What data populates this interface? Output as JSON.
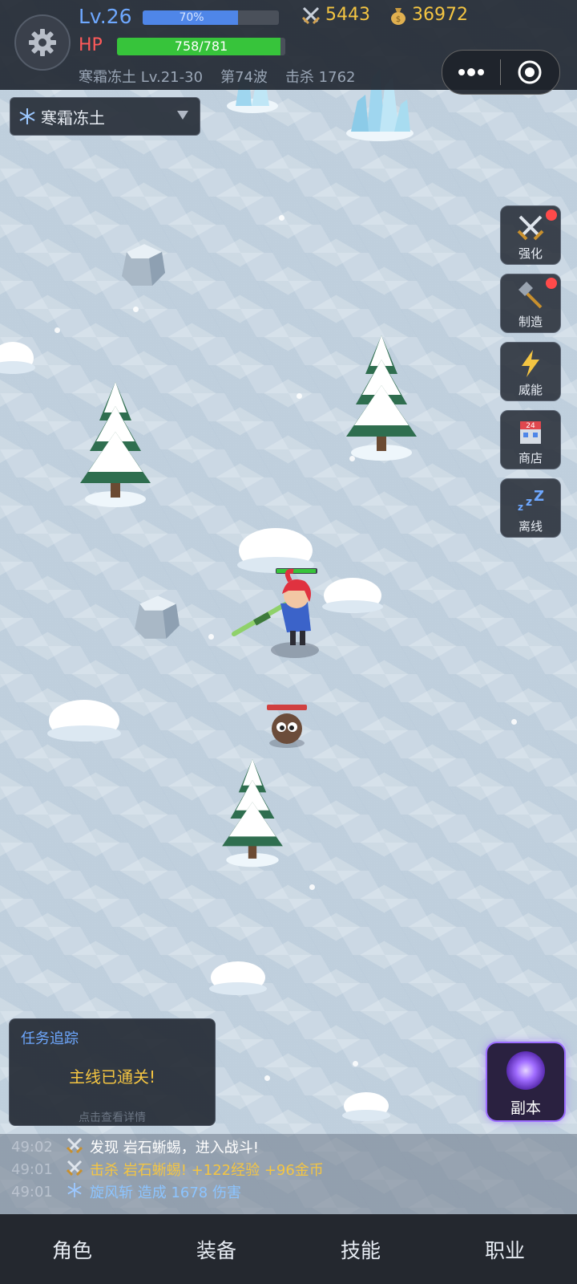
{
  "hud": {
    "level": "Lv.26",
    "xp_percent_text": "70%",
    "xp_progress": 0.7,
    "hp_label": "HP",
    "hp_text": "758/781",
    "hp_progress": 0.97,
    "attack": "5443",
    "gold": "36972",
    "zone_name": "寒霜冻土 Lv.21-30",
    "wave": "第74波",
    "kills": "击杀 1762"
  },
  "zone_selector": {
    "icon": "snowflake-icon",
    "label": "寒霜冻土"
  },
  "side_buttons": [
    {
      "label": "强化",
      "icon": "swords-icon",
      "badge": true
    },
    {
      "label": "制造",
      "icon": "hammer-icon",
      "badge": true
    },
    {
      "label": "威能",
      "icon": "lightning-icon",
      "badge": false
    },
    {
      "label": "商店",
      "icon": "shop-icon",
      "badge": false
    },
    {
      "label": "离线",
      "icon": "sleep-icon",
      "badge": false
    }
  ],
  "quest": {
    "title": "任务追踪",
    "message": "主线已通关!",
    "hint": "点击查看详情"
  },
  "dungeon": {
    "label": "副本",
    "icon": "vortex-icon"
  },
  "log": [
    {
      "time": "49:02",
      "icon": "swords-icon",
      "text": "发现 岩石蜥蜴，进入战斗!",
      "color": "#ffffff"
    },
    {
      "time": "49:01",
      "icon": "swords-icon",
      "text": "击杀 岩石蜥蜴! +122经验 +96金币",
      "color": "#f4c542"
    },
    {
      "time": "49:01",
      "icon": "snowflake-icon",
      "text": "旋风斩 造成 1678 伤害",
      "color": "#8cc4ff"
    }
  ],
  "nav": [
    "角色",
    "装备",
    "技能",
    "职业"
  ],
  "colors": {
    "xp": "#4f86e8",
    "hp": "#37c43b",
    "gold": "#f4c542",
    "level": "#6ea8ff",
    "badge": "#ff4a4a"
  }
}
